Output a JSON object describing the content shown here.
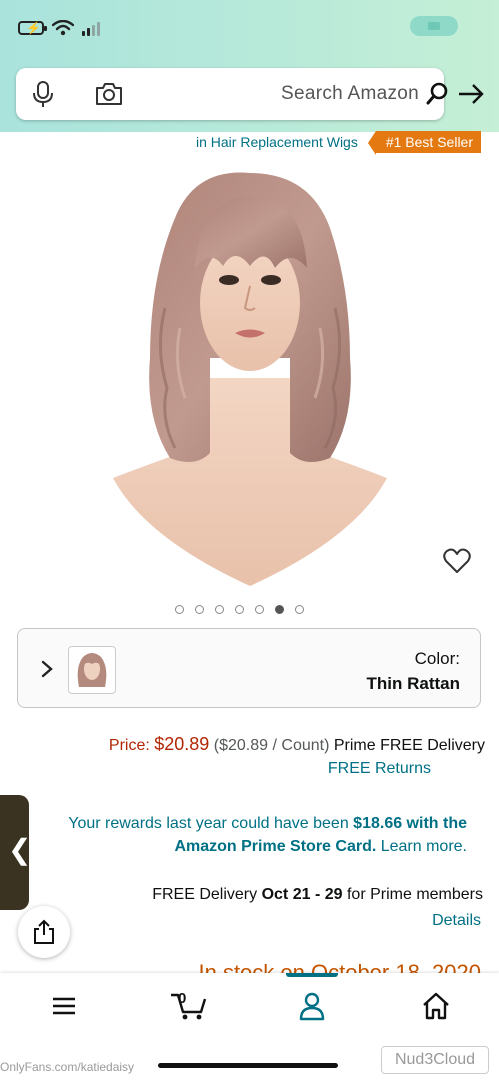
{
  "status_bar": {
    "icons": [
      "battery-charging-icon",
      "wifi-icon",
      "cellular-signal-icon"
    ]
  },
  "search": {
    "placeholder": "Search Amazon"
  },
  "best_seller": {
    "badge": "#1 Best Seller",
    "category": "in Hair Replacement Wigs"
  },
  "carousel": {
    "count": 7,
    "active_index": 5
  },
  "color": {
    "label": "Color:",
    "value": "Thin Rattan"
  },
  "price": {
    "label": "Price:",
    "value": "$20.89",
    "per_count": "($20.89 / Count)",
    "prime_note": "Prime FREE Delivery",
    "returns": "FREE Returns"
  },
  "rewards": {
    "prefix": "Your rewards last year could have been",
    "amount": "$18.66 with the Amazon Prime Store Card.",
    "link": "Learn more."
  },
  "delivery": {
    "prefix": "FREE Delivery",
    "dates": "Oct 21 - 29",
    "suffix": "for Prime members",
    "details": "Details"
  },
  "stock": {
    "text": "In stock on October 18, 2020"
  },
  "side_tab": {
    "glyph": "❮"
  },
  "bottom_nav": {
    "cart_count": "0",
    "active": "account"
  },
  "watermark": {
    "left": "OnlyFans.com/katiedaisy",
    "right": "Nud3Cloud"
  },
  "colors": {
    "header": "#b8ead9",
    "link": "#007185",
    "price": "#b12704",
    "badge": "#e47911"
  }
}
